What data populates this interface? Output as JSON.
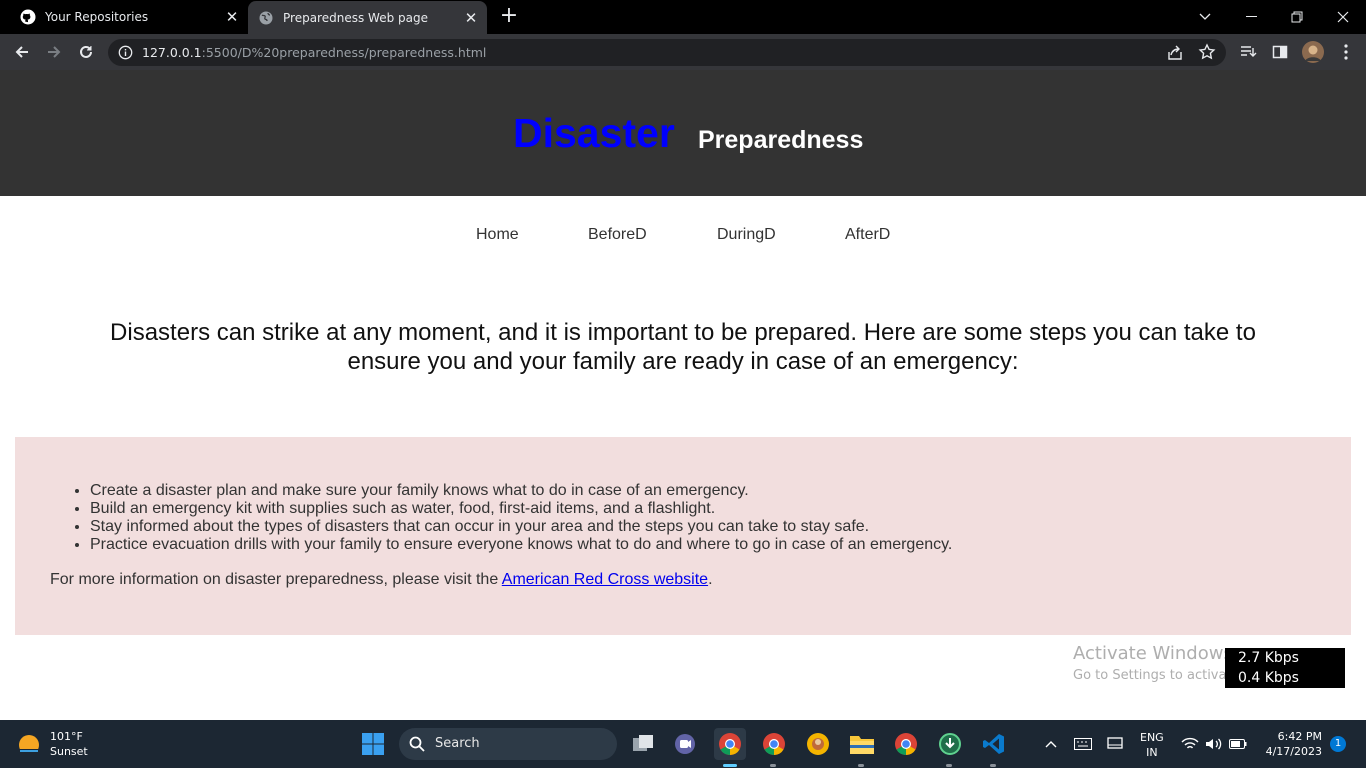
{
  "browser": {
    "tabs": [
      {
        "title": "Your Repositories",
        "favicon": "github-icon",
        "active": false
      },
      {
        "title": "Preparedness Web page",
        "favicon": "globe-icon",
        "active": true
      }
    ],
    "url_host": "127.0.0.1",
    "url_rest": ":5500/D%20preparedness/preparedness.html"
  },
  "page": {
    "brand_primary": "Disaster",
    "brand_secondary": "Preparedness",
    "nav": [
      "Home",
      "BeforeD",
      "DuringD",
      "AfterD"
    ],
    "intro": "Disasters can strike at any moment, and it is important to be prepared. Here are some steps you can take to ensure you and your family are ready in case of an emergency:",
    "steps": [
      "Create a disaster plan and make sure your family knows what to do in case of an emergency.",
      "Build an emergency kit with supplies such as water, food, first-aid items, and a flashlight.",
      "Stay informed about the types of disasters that can occur in your area and the steps you can take to stay safe.",
      "Practice evacuation drills with your family to ensure everyone knows what to do and where to go in case of an emergency."
    ],
    "more_info_prefix": "For more information on disaster preparedness, please visit the ",
    "more_info_link": "American Red Cross website",
    "more_info_suffix": "."
  },
  "overlay": {
    "activate_title": "Activate Windows",
    "activate_sub": "Go to Settings to activate Windows.",
    "upload_speed": "2.7 Kbps",
    "download_speed": "0.4 Kbps"
  },
  "taskbar": {
    "weather_temp": "101°F",
    "weather_desc": "Sunset",
    "search_label": "Search",
    "lang_1": "ENG",
    "lang_2": "IN",
    "time": "6:42 PM",
    "date": "4/17/2023",
    "notification_count": "1"
  },
  "colors": {
    "header_bg": "#333333",
    "brand_primary": "#0000ff",
    "panel_bg": "#f2dede",
    "link": "#0000ee"
  }
}
